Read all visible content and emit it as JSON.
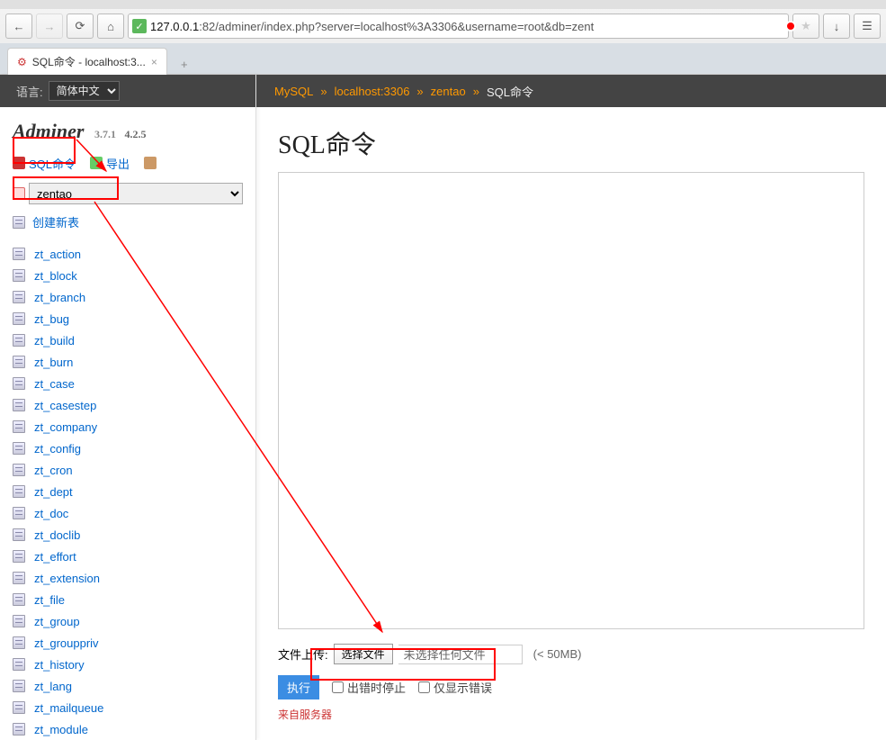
{
  "browser": {
    "url_host": "127.0.0.1",
    "url_path": ":82/adminer/index.php?server=localhost%3A3306&username=root&db=zent",
    "tab_title": "SQL命令 - localhost:3...",
    "tab_icon": "⚙"
  },
  "lang": {
    "label": "语言:",
    "value": "简体中文"
  },
  "brand": {
    "name": "Adminer",
    "v1": "3.7.1",
    "v2": "4.2.5"
  },
  "actions": {
    "sql": "SQL命令",
    "export": "导出"
  },
  "db": {
    "selected": "zentao"
  },
  "create_table": "创建新表",
  "tables": [
    "zt_action",
    "zt_block",
    "zt_branch",
    "zt_bug",
    "zt_build",
    "zt_burn",
    "zt_case",
    "zt_casestep",
    "zt_company",
    "zt_config",
    "zt_cron",
    "zt_dept",
    "zt_doc",
    "zt_doclib",
    "zt_effort",
    "zt_extension",
    "zt_file",
    "zt_group",
    "zt_grouppriv",
    "zt_history",
    "zt_lang",
    "zt_mailqueue",
    "zt_module"
  ],
  "breadcrumb": {
    "engine": "MySQL",
    "host": "localhost:3306",
    "db": "zentao",
    "page": "SQL命令"
  },
  "title": "SQL命令",
  "upload": {
    "label": "文件上传:",
    "button": "选择文件",
    "status": "未选择任何文件",
    "hint": "(< 50MB)"
  },
  "run": {
    "button": "执行",
    "stop_on_error": "出错时停止",
    "show_errors_only": "仅显示错误"
  },
  "bottom_link": "来自服务器"
}
